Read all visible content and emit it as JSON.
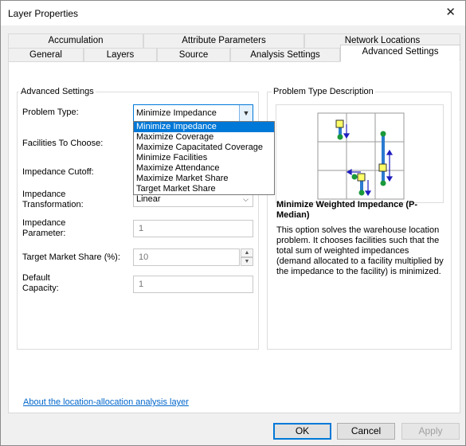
{
  "window": {
    "title": "Layer Properties"
  },
  "tabs_row1": [
    "Accumulation",
    "Attribute Parameters",
    "Network Locations"
  ],
  "tabs_row2": [
    "General",
    "Layers",
    "Source",
    "Analysis Settings",
    "Advanced Settings"
  ],
  "advanced": {
    "group_label": "Advanced Settings",
    "problem_type_label": "Problem Type:",
    "problem_type_value": "Minimize Impedance",
    "facilities_label": "Facilities To Choose:",
    "impedance_cutoff_label": "Impedance Cutoff:",
    "impedance_transformation_label": "Impedance Transformation:",
    "impedance_transformation_value": "Linear",
    "impedance_parameter_label": "Impedance Parameter:",
    "impedance_parameter_value": "1",
    "target_market_share_label": "Target Market Share (%):",
    "target_market_share_value": "10",
    "default_capacity_label": "Default Capacity:",
    "default_capacity_value": "1"
  },
  "dropdown_options": [
    "Minimize Impedance",
    "Maximize Coverage",
    "Maximize Capacitated Coverage",
    "Minimize Facilities",
    "Maximize Attendance",
    "Maximize Market Share",
    "Target Market Share"
  ],
  "description": {
    "group_label": "Problem Type Description",
    "title": "Minimize Weighted Impedance (P-Median)",
    "text": "This option solves the warehouse location problem. It chooses facilities such that the total sum of weighted impedances (demand allocated to a facility multiplied by the impedance to the facility) is minimized."
  },
  "link": "About the location-allocation analysis layer",
  "buttons": {
    "ok": "OK",
    "cancel": "Cancel",
    "apply": "Apply"
  },
  "icons": {
    "close": "close-icon",
    "dropdown": "chevron-down-icon",
    "spin_up": "spin-up-icon",
    "spin_down": "spin-down-icon"
  },
  "colors": {
    "selection": "#0078d7",
    "link": "#0066cc",
    "facility": "#1a9a3a",
    "demand": "#ffff66",
    "arrow": "#1f1fbf"
  }
}
